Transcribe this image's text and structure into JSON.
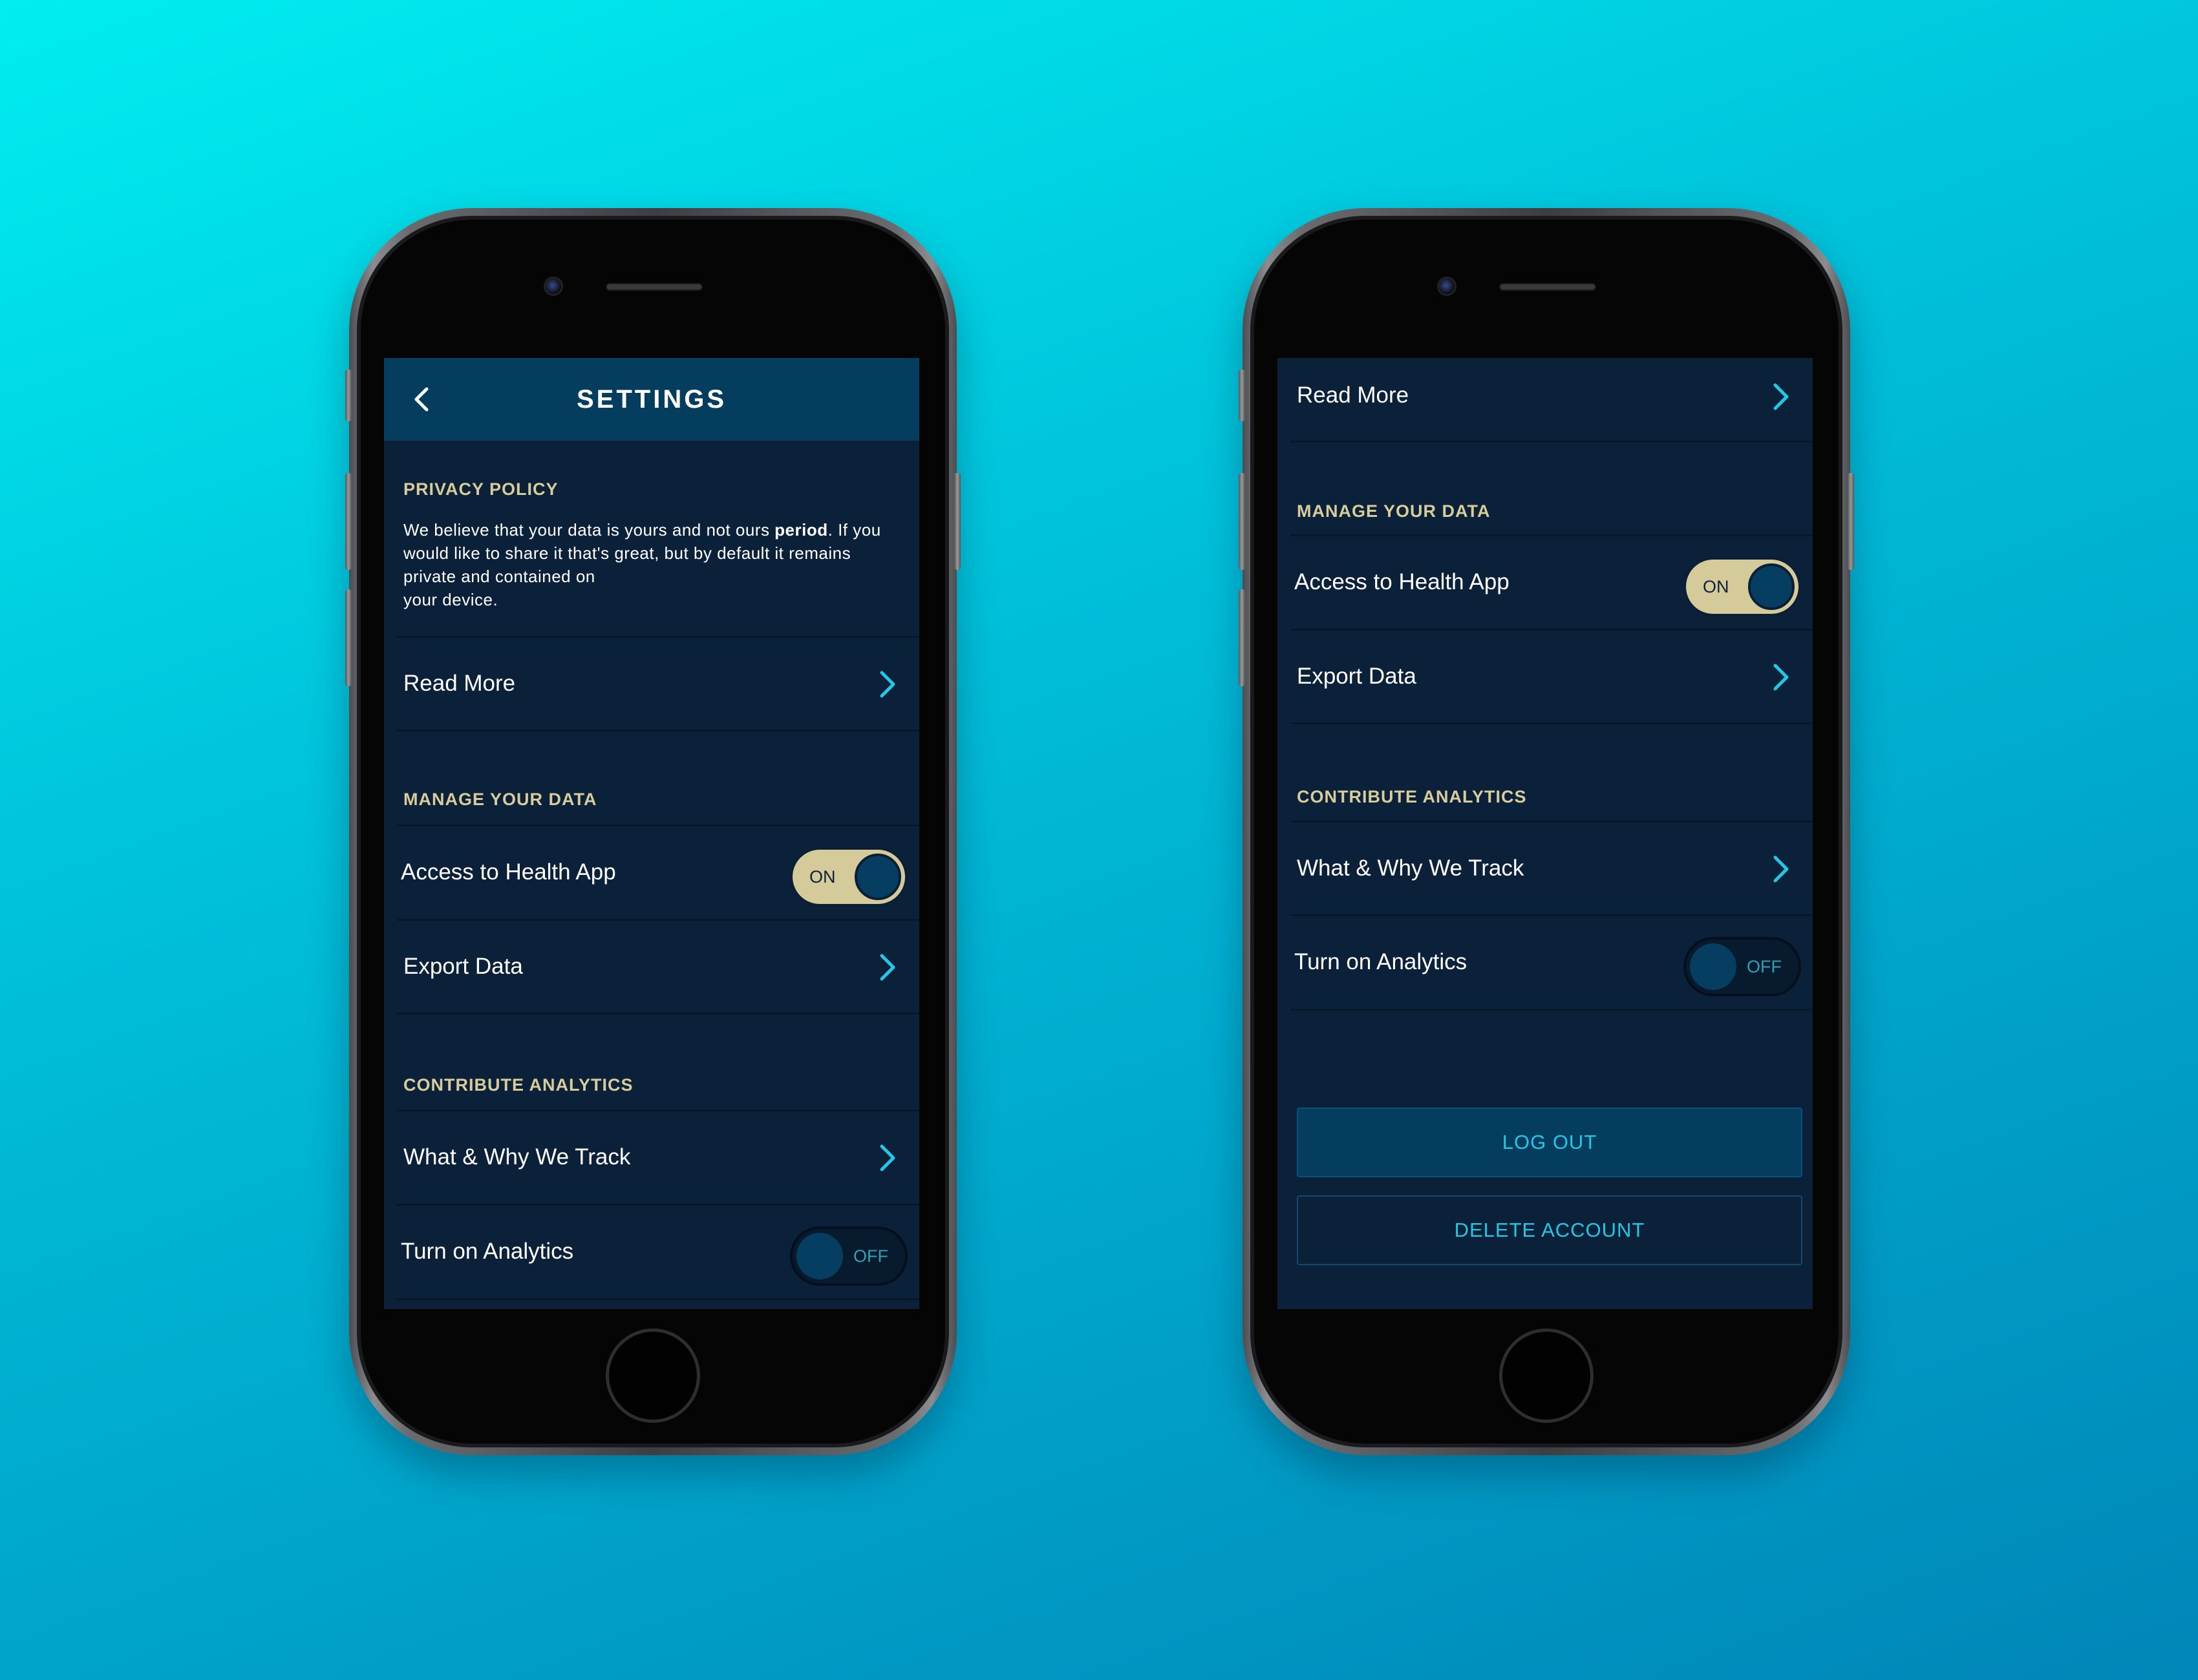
{
  "colors": {
    "background_start": "#00eef0",
    "background_end": "#0086b8",
    "screen_bg": "#0b213a",
    "navbar_bg": "#053d5f",
    "section_header": "#d8cc9a",
    "accent": "#24c8e6",
    "toggle_on": "#d5cb9a"
  },
  "phone1": {
    "title": "SETTINGS",
    "back_icon": "chevron-left-icon",
    "privacy": {
      "header": "PRIVACY POLICY",
      "text_before": "We believe that your data is yours and not ours ",
      "text_bold": "period",
      "text_after": ". If you would like to share it that's great, but by default it remains private and contained on",
      "text_last": "your device."
    },
    "read_more": "Read More",
    "manage_header": "MANAGE YOUR DATA",
    "health_label": "Access to Health App",
    "health_toggle": "ON",
    "export_label": "Export Data",
    "analytics_header": "CONTRIBUTE ANALYTICS",
    "track_label": "What & Why We Track",
    "analytics_label": "Turn on Analytics",
    "analytics_toggle": "OFF"
  },
  "phone2": {
    "read_more": "Read More",
    "manage_header": "MANAGE YOUR DATA",
    "health_label": "Access to Health App",
    "health_toggle": "ON",
    "export_label": "Export Data",
    "analytics_header": "CONTRIBUTE ANALYTICS",
    "track_label": "What & Why We Track",
    "analytics_label": "Turn on Analytics",
    "analytics_toggle": "OFF",
    "logout": "LOG OUT",
    "delete_account": "DELETE ACCOUNT"
  }
}
